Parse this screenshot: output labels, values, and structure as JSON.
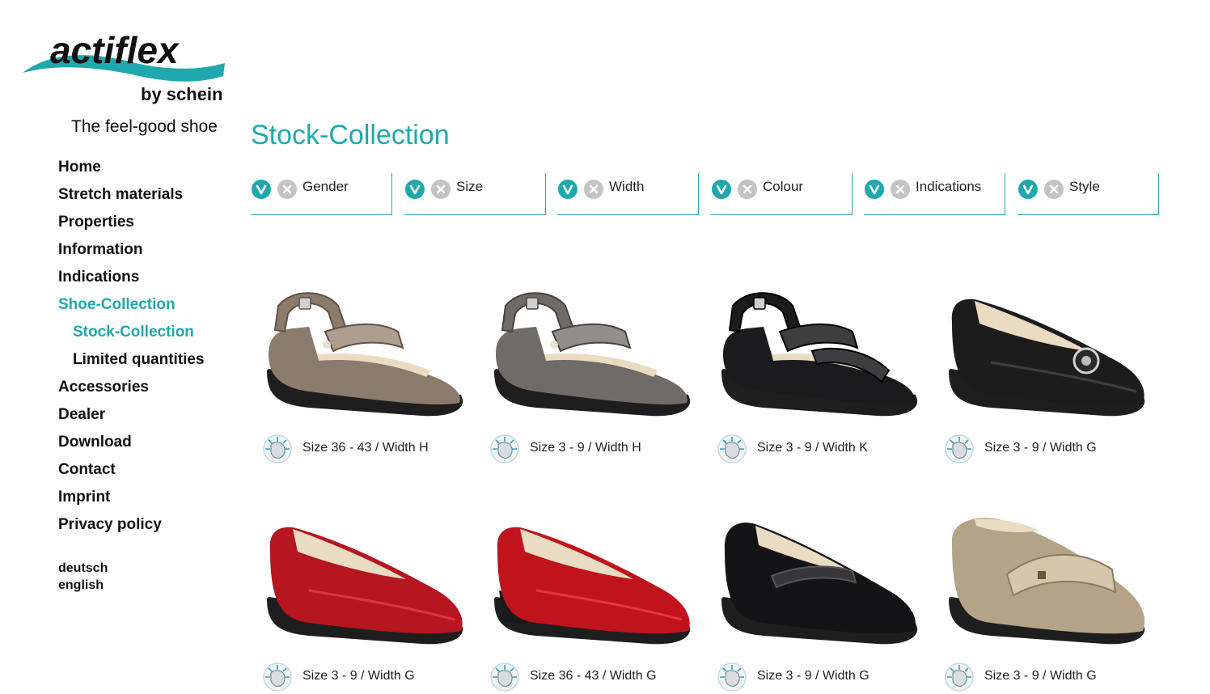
{
  "brand": {
    "logo_primary": "actiflex",
    "logo_secondary": "by schein",
    "tagline": "The feel-good shoe"
  },
  "colors": {
    "accent": "#1fa8ae",
    "text": "#111111",
    "inactive_button": "#c4c4c4"
  },
  "nav": {
    "items": [
      {
        "label": "Home",
        "active": false,
        "sub": false
      },
      {
        "label": "Stretch materials",
        "active": false,
        "sub": false
      },
      {
        "label": "Properties",
        "active": false,
        "sub": false
      },
      {
        "label": "Information",
        "active": false,
        "sub": false
      },
      {
        "label": "Indications",
        "active": false,
        "sub": false
      },
      {
        "label": "Shoe-Collection",
        "active": true,
        "sub": false
      },
      {
        "label": "Stock-Collection",
        "active": true,
        "sub": true
      },
      {
        "label": "Limited quantities",
        "active": false,
        "sub": true
      },
      {
        "label": "Accessories",
        "active": false,
        "sub": false
      },
      {
        "label": "Dealer",
        "active": false,
        "sub": false
      },
      {
        "label": "Download",
        "active": false,
        "sub": false
      },
      {
        "label": "Contact",
        "active": false,
        "sub": false
      },
      {
        "label": "Imprint",
        "active": false,
        "sub": false
      },
      {
        "label": "Privacy policy",
        "active": false,
        "sub": false
      }
    ],
    "languages": [
      "deutsch",
      "english"
    ]
  },
  "page": {
    "title": "Stock-Collection"
  },
  "filters": [
    {
      "label": "Gender",
      "icons": [
        "check-icon",
        "close-icon"
      ]
    },
    {
      "label": "Size",
      "icons": [
        "check-icon",
        "close-icon"
      ]
    },
    {
      "label": "Width",
      "icons": [
        "check-icon",
        "close-icon"
      ]
    },
    {
      "label": "Colour",
      "icons": [
        "check-icon",
        "close-icon"
      ]
    },
    {
      "label": "Indications",
      "icons": [
        "check-icon",
        "close-icon"
      ]
    },
    {
      "label": "Style",
      "icons": [
        "check-icon",
        "close-icon"
      ]
    }
  ],
  "products": [
    {
      "caption": "Size 36 - 43 / Width H",
      "style": "sandal",
      "color": "#8a7b6c"
    },
    {
      "caption": "Size 3 - 9 / Width H",
      "style": "sandal",
      "color": "#6f6b66"
    },
    {
      "caption": "Size 3 - 9 / Width K",
      "style": "open-sandal",
      "color": "#1b1b1d"
    },
    {
      "caption": "Size 3 - 9 / Width G",
      "style": "loafer",
      "color": "#1c1c1c"
    },
    {
      "caption": "Size 3 - 9 / Width G",
      "style": "pump",
      "color": "#b5161f"
    },
    {
      "caption": "Size 36 - 43 / Width G",
      "style": "heel-pump",
      "color": "#c0141d"
    },
    {
      "caption": "Size 3 - 9 / Width G",
      "style": "mary-jane",
      "color": "#141416"
    },
    {
      "caption": "Size 3 - 9 / Width G",
      "style": "velcro-shoe",
      "color": "#b3a488"
    }
  ]
}
